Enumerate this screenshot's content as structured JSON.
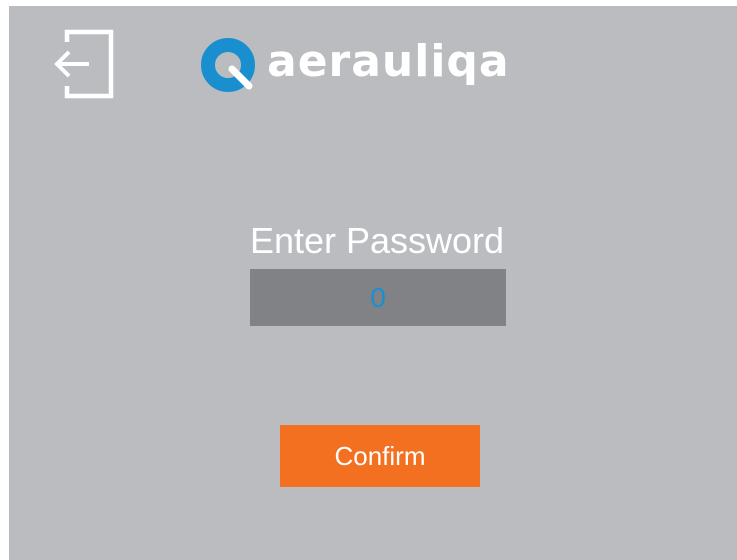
{
  "header": {
    "logout_icon": "logout-icon",
    "logo_icon": "aerauliqa-logo-mark",
    "brand_name": "aerauliqa"
  },
  "login": {
    "label": "Enter Password",
    "password_value": "0",
    "confirm_label": "Confirm"
  },
  "colors": {
    "background": "#bbbcc0",
    "field_background": "#818286",
    "field_text": "#1a8fd0",
    "brand_blue": "#1a8fd0",
    "button": "#f37020",
    "text": "#ffffff"
  }
}
